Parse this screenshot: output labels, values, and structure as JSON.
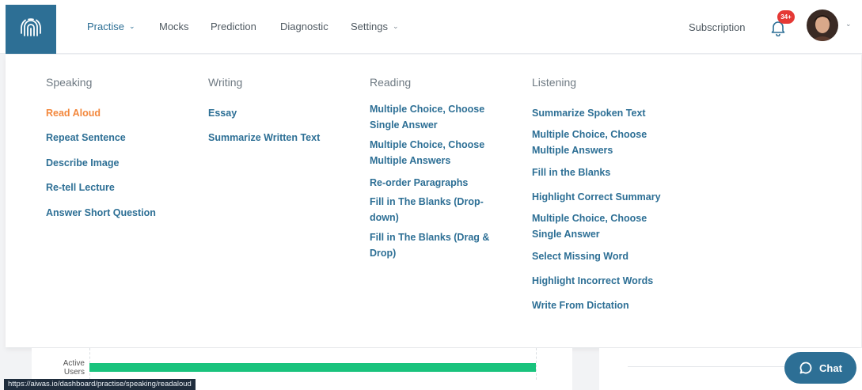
{
  "nav": {
    "items": [
      {
        "label": "Practise",
        "active": true,
        "has_dropdown": true
      },
      {
        "label": "Mocks",
        "active": false,
        "has_dropdown": false
      },
      {
        "label": "Prediction",
        "active": false,
        "has_dropdown": false
      },
      {
        "label": "Diagnostic",
        "active": false,
        "has_dropdown": false
      },
      {
        "label": "Settings",
        "active": false,
        "has_dropdown": true
      }
    ],
    "subscription_label": "Subscription",
    "notification_count": "34+",
    "logo_icon": "fingerprint-icon",
    "bell_icon": "bell-icon"
  },
  "menu": {
    "columns": [
      {
        "heading": "Speaking",
        "items": [
          "Read Aloud",
          "Repeat Sentence",
          "Describe Image",
          "Re-tell Lecture",
          "Answer Short Question"
        ]
      },
      {
        "heading": "Writing",
        "items": [
          "Essay",
          "Summarize Written Text"
        ]
      },
      {
        "heading": "Reading",
        "items": [
          "Multiple Choice, Choose Single Answer",
          "Multiple Choice, Choose Multiple Answers",
          "Re-order Paragraphs",
          "Fill in The Blanks (Drop-down)",
          "Fill in The Blanks (Drag & Drop)"
        ]
      },
      {
        "heading": "Listening",
        "items": [
          "Summarize Spoken Text",
          "Multiple Choice, Choose Multiple Answers",
          "Fill in the Blanks",
          "Highlight Correct Summary",
          "Multiple Choice, Choose Single Answer",
          "Select Missing Word",
          "Highlight Incorrect Words",
          "Write From Dictation"
        ]
      }
    ],
    "selected_item": "Read Aloud"
  },
  "background": {
    "chart_label_line1": "Active",
    "chart_label_line2": "Users"
  },
  "status_url": "https://aiwas.io/dashboard/practise/speaking/readaloud",
  "chat": {
    "label": "Chat",
    "icon": "chat-bubble-icon"
  },
  "colors": {
    "brand": "#2d6f95",
    "selected": "#f3883d",
    "badge": "#e53935",
    "bar": "#19c37d"
  }
}
